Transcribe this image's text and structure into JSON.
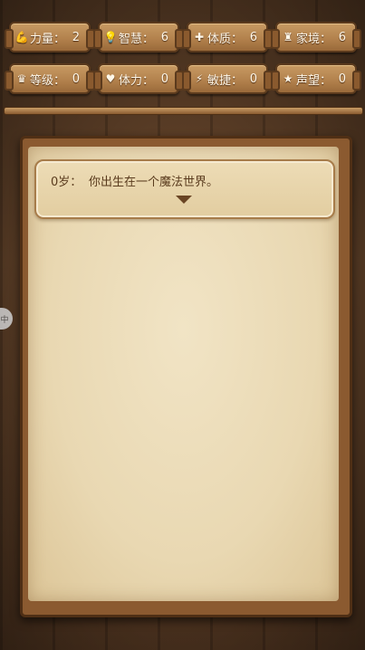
{
  "stats_row1": [
    {
      "icon": "strength-icon",
      "glyph": "💪",
      "label": "力量：",
      "value": "2"
    },
    {
      "icon": "wisdom-icon",
      "glyph": "💡",
      "label": "智慧：",
      "value": "6"
    },
    {
      "icon": "constitution-icon",
      "glyph": "✚",
      "label": "体质：",
      "value": "6"
    },
    {
      "icon": "family-icon",
      "glyph": "♜",
      "label": "家境：",
      "value": "6"
    }
  ],
  "stats_row2": [
    {
      "icon": "level-crown-icon",
      "glyph": "♛",
      "label": "等级：",
      "value": "0"
    },
    {
      "icon": "stamina-heart-icon",
      "glyph": "♥",
      "label": "体力：",
      "value": "0"
    },
    {
      "icon": "agility-lightning-icon",
      "glyph": "⚡",
      "label": "敏捷：",
      "value": "0"
    },
    {
      "icon": "reputation-star-icon",
      "glyph": "★",
      "label": "声望：",
      "value": "0"
    }
  ],
  "log": {
    "entries": [
      {
        "age": "0岁：",
        "text": "你出生在一个魔法世界。"
      }
    ]
  },
  "side_handle": "中"
}
